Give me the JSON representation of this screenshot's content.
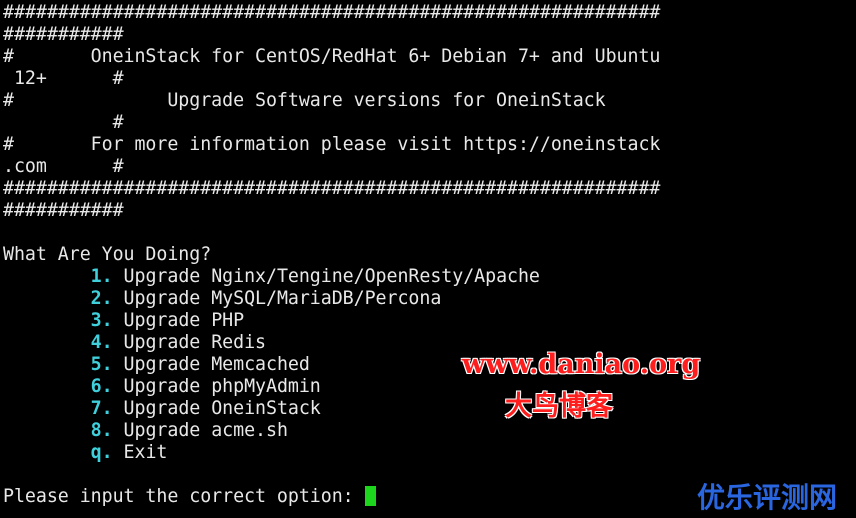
{
  "terminal": {
    "banner": [
      "############################################################",
      "###########",
      "#       OneinStack for CentOS/RedHat 6+ Debian 7+ and Ubuntu",
      " 12+      #",
      "#              Upgrade Software versions for OneinStack",
      "          #",
      "#       For more information please visit https://oneinstack",
      ".com      #",
      "############################################################",
      "###########"
    ],
    "question": "What Are You Doing?",
    "options": [
      {
        "key": "1",
        "label": " Upgrade Nginx/Tengine/OpenResty/Apache"
      },
      {
        "key": "2",
        "label": " Upgrade MySQL/MariaDB/Percona"
      },
      {
        "key": "3",
        "label": " Upgrade PHP"
      },
      {
        "key": "4",
        "label": " Upgrade Redis"
      },
      {
        "key": "5",
        "label": " Upgrade Memcached"
      },
      {
        "key": "6",
        "label": " Upgrade phpMyAdmin"
      },
      {
        "key": "7",
        "label": " Upgrade OneinStack"
      },
      {
        "key": "8",
        "label": " Upgrade acme.sh"
      },
      {
        "key": "q",
        "label": " Exit"
      }
    ],
    "option_separator": ".",
    "prompt": "Please input the correct option: "
  },
  "watermarks": {
    "url": "www.daniao.org",
    "blog_name": "大鸟博客",
    "corner": "优乐评测网"
  },
  "colors": {
    "background": "#000000",
    "text": "#e8e8e8",
    "option_number": "#3fd0dc",
    "cursor": "#1ed51e",
    "watermark_red": "#ff1e1e",
    "watermark_blue": "#2a66e0"
  }
}
